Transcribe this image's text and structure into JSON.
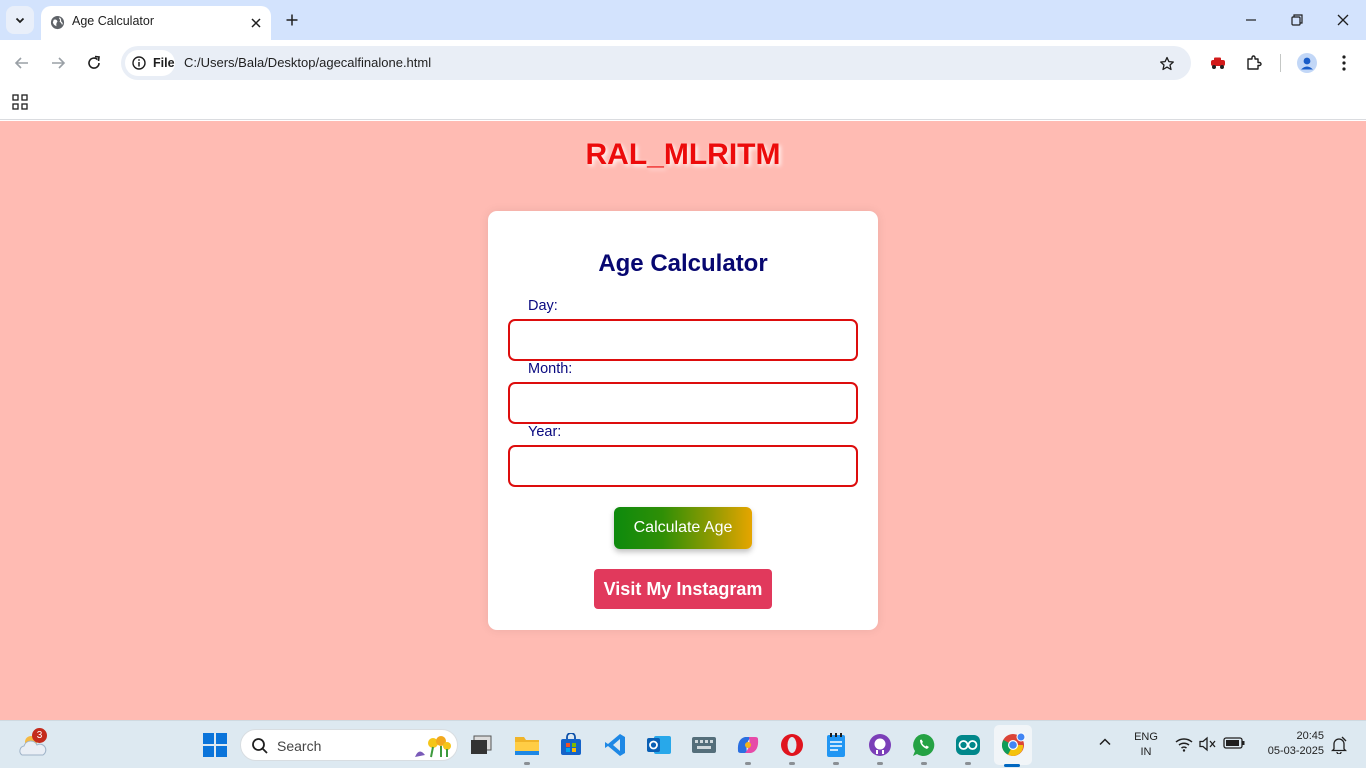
{
  "browser": {
    "tab_title": "Age Calculator",
    "site_chip_label": "File",
    "url": "C:/Users/Bala/Desktop/agecalfinalone.html"
  },
  "page": {
    "site_title": "RAL_MLRITM",
    "card_title": "Age Calculator",
    "fields": [
      {
        "label": "Day:",
        "value": ""
      },
      {
        "label": "Month:",
        "value": ""
      },
      {
        "label": "Year:",
        "value": ""
      }
    ],
    "calculate_label": "Calculate Age",
    "instagram_label": "Visit My Instagram",
    "colors": {
      "background": "#ffbbb3",
      "site_title": "#ec0b0b",
      "card_title": "#070770",
      "field_border": "#dd0d0d",
      "instagram_button": "#e1395c"
    }
  },
  "taskbar": {
    "weather_badge": "3",
    "search_placeholder": "Search",
    "apps": [
      "file-explorer-dark-icon",
      "folder-icon",
      "store-icon",
      "vscode-icon",
      "outlook-icon",
      "keyboard-app-icon",
      "copilot-icon",
      "opera-icon",
      "notepad-icon",
      "github-icon",
      "whatsapp-icon",
      "arduino-icon",
      "chrome-icon"
    ],
    "language_line1": "ENG",
    "language_line2": "IN",
    "time": "20:45",
    "date": "05-03-2025"
  }
}
